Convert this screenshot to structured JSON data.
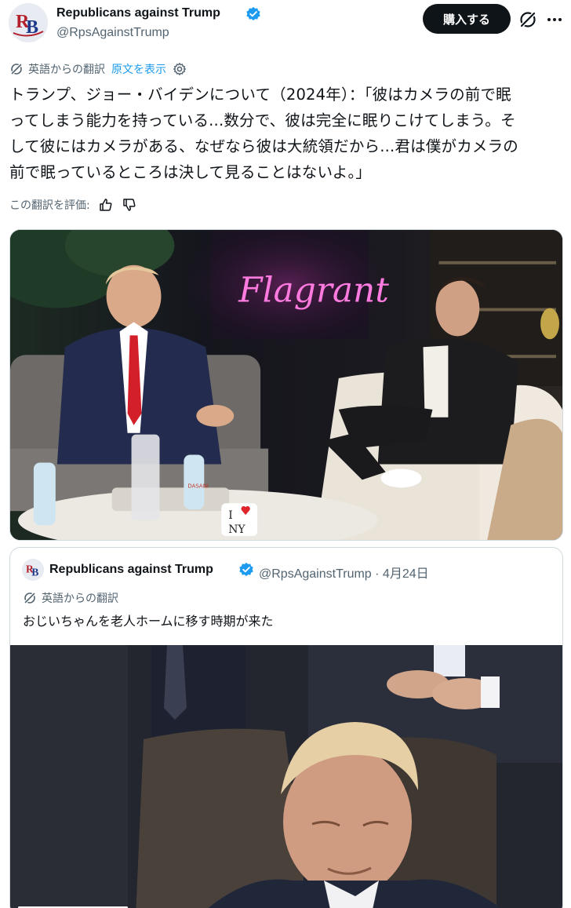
{
  "author": {
    "name": "Republicans against Trump",
    "handle": "@RpsAgainstTrump",
    "verified": true,
    "avatar_text": "RB"
  },
  "actions": {
    "buy_label": "購入する"
  },
  "translation": {
    "label": "英語からの翻訳",
    "show_original": "原文を表示"
  },
  "tweet": {
    "lines": [
      "トランプ、ジョー・バイデンについて（2024年）：「彼はカメラの前で眠",
      "ってしまう能力を持っている...数分で、彼は完全に眠りこけてしまう。そ",
      "して彼にはカメラがある、なぜなら彼は大統領だから...君は僕がカメラの",
      "前で眠っているところは決して見ることはないよ。」"
    ]
  },
  "rating": {
    "label": "この翻訳を評価:"
  },
  "media": {
    "neon_sign": "Flagrant",
    "bottle_label": "DASANI",
    "mug_text_top": "I",
    "mug_text_bottom": "NY"
  },
  "quote": {
    "name": "Republicans against Trump",
    "handle_date": "@RpsAgainstTrump · 4月24日",
    "translation_label": "英語からの翻訳",
    "text": "おじいちゃんを老人ホームに移す時期が来た"
  },
  "colors": {
    "accent": "#1d9bf0",
    "text": "#0f1419",
    "muted": "#536471",
    "button_dark": "#0f1419",
    "verified_badge": "#1d9bf0"
  },
  "icons": [
    "verified-badge-icon",
    "grok-icon",
    "translate-icon",
    "gear-icon",
    "thumbs-up-icon",
    "thumbs-down-icon"
  ]
}
